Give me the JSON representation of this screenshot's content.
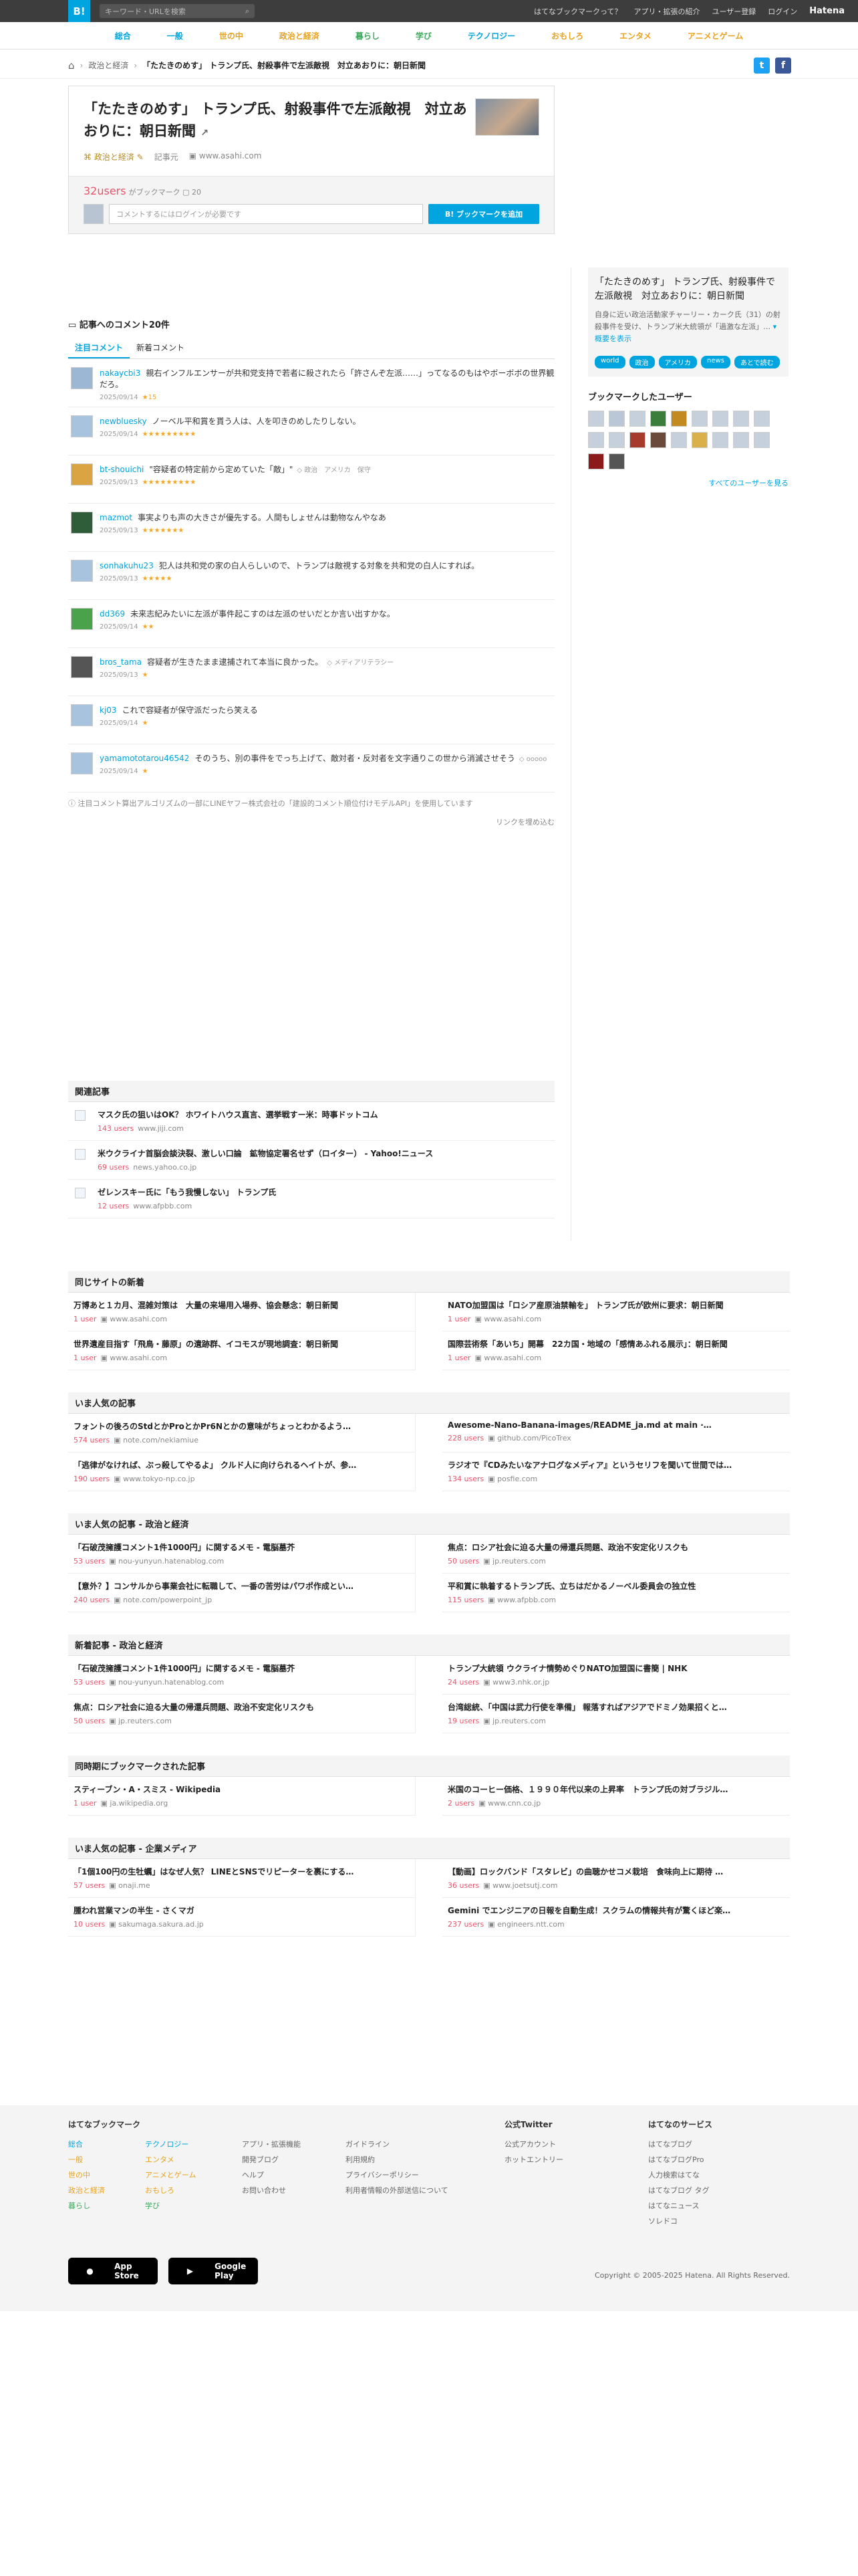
{
  "topbar": {
    "logo": "B!",
    "search_placeholder": "キーワード・URLを検索",
    "links": [
      "はてなブックマークって？",
      "アプリ・拡張の紹介",
      "ユーザー登録",
      "ログイン"
    ],
    "brand": "Hatena"
  },
  "categories": [
    {
      "label": "総合",
      "color": "#00a4de"
    },
    {
      "label": "一般",
      "color": "#00a4de"
    },
    {
      "label": "世の中",
      "color": "#e9a21d"
    },
    {
      "label": "政治と経済",
      "color": "#e9a21d"
    },
    {
      "label": "暮らし",
      "color": "#3daa5e"
    },
    {
      "label": "学び",
      "color": "#3daa5e"
    },
    {
      "label": "テクノロジー",
      "color": "#00a4de"
    },
    {
      "label": "おもしろ",
      "color": "#e9a21d"
    },
    {
      "label": "エンタメ",
      "color": "#e9a21d"
    },
    {
      "label": "アニメとゲーム",
      "color": "#e9a21d"
    }
  ],
  "breadcrumb": {
    "cat": "政治と経済",
    "current": "「たたきのめす」 トランプ氏、射殺事件で左派敵視　対立あおりに：朝日新聞"
  },
  "entry": {
    "title": "「たたきのめす」 トランプ氏、射殺事件で左派敵視　対立あおりに：朝日新聞",
    "category": "政治と経済",
    "kind": "記事元",
    "domain": "www.asahi.com",
    "users": "32users",
    "bm_label": "がブックマーク",
    "bm_count": "20",
    "comment_placeholder": "コメントするにはログインが必要です",
    "add_button": "B! ブックマークを追加"
  },
  "comments_section": {
    "title": "記事へのコメント20件",
    "tab_hot": "注目コメント",
    "tab_new": "新着コメント",
    "note": "ⓘ 注目コメント算出アルゴリズムの一部にLINEヤフー株式会社の「建設的コメント順位付けモデルAPI」を使用しています",
    "more": "リンクを埋め込む"
  },
  "comments": [
    {
      "user": "nakaycbi3",
      "text": "親右インフルエンサーが共和党支持で若者に殺されたら「許さんぞ左派……」ってなるのもはやボーボボの世界観だろ。",
      "tag": "",
      "date": "2025/09/14",
      "stars": "★15"
    },
    {
      "user": "newbluesky",
      "text": "ノーベル平和賞を貰う人は、人を叩きのめしたりしない。",
      "tag": "",
      "date": "2025/09/14",
      "stars": "★★★★★★★★★"
    },
    {
      "user": "bt-shouichi",
      "text": "\"容疑者の特定前から定めていた「敵」\"",
      "tag": "政治　アメリカ　保守",
      "date": "2025/09/13",
      "stars": "★★★★★★★★★"
    },
    {
      "user": "mazmot",
      "text": "事実よりも声の大きさが優先する。人間もしょせんは動物なんやなあ",
      "tag": "",
      "date": "2025/09/13",
      "stars": "★★★★★★★"
    },
    {
      "user": "sonhakuhu23",
      "text": "犯人は共和党の家の白人らしいので、トランプは敵視する対象を共和党の白人にすれば。",
      "tag": "",
      "date": "2025/09/13",
      "stars": "★★★★★"
    },
    {
      "user": "dd369",
      "text": "未来志紀みたいに左派が事件起こすのは左派のせいだとか言い出すかな。",
      "tag": "",
      "date": "2025/09/14",
      "stars": "★★"
    },
    {
      "user": "bros_tama",
      "text": "容疑者が生きたまま逮捕されて本当に良かった。",
      "tag": "メディアリテラシー",
      "date": "2025/09/13",
      "stars": "★"
    },
    {
      "user": "kj03",
      "text": "これで容疑者が保守派だったら笑える",
      "tag": "",
      "date": "2025/09/14",
      "stars": "★"
    },
    {
      "user": "yamamototarou46542",
      "text": "そのうち、別の事件をでっち上げて、敵対者・反対者を文字通りこの世から消滅させそう",
      "tag": "ooooo",
      "date": "2025/09/14",
      "stars": "★"
    }
  ],
  "related": {
    "title": "関連記事",
    "items": [
      {
        "title": "マスク氏の狙いはOK？ ホワイトハウス直言、選挙戦すー米：時事ドットコム",
        "users": "143 users",
        "domain": "www.jiji.com"
      },
      {
        "title": "米ウクライナ首脳会談決裂、激しい口論　鉱物協定署名せず（ロイター） - Yahoo!ニュース",
        "users": "69 users",
        "domain": "news.yahoo.co.jp"
      },
      {
        "title": "ゼレンスキー氏に「もう我慢しない」 トランプ氏",
        "users": "12 users",
        "domain": "www.afpbb.com"
      }
    ]
  },
  "sidebar": {
    "title": "「たたきのめす」 トランプ氏、射殺事件で左派敵視　対立あおりに：朝日新聞",
    "desc": "自身に近い政治活動家チャーリー・カーク氏（31）の射殺事件を受け、トランプ米大統領が「過激な左派」…",
    "more": "概要を表示",
    "tags": [
      "world",
      "政治",
      "アメリカ",
      "news",
      "あとで読む"
    ],
    "users_title": "ブックマークしたユーザー",
    "all_users": "すべてのユーザーを見る"
  },
  "blocks": [
    {
      "title": "同じサイトの新着",
      "items": [
        {
          "title": "万博あと１カ月、混雑対策は　大量の来場用入場券、協会懸念：朝日新聞",
          "users": "1 user",
          "domain": "www.asahi.com"
        },
        {
          "title": "NATO加盟国は「ロシア産原油禁輸を」 トランプ氏が欧州に要求：朝日新聞",
          "users": "1 user",
          "domain": "www.asahi.com"
        },
        {
          "title": "世界遺産目指す「飛鳥・藤原」の遺跡群、イコモスが現地調査：朝日新聞",
          "users": "1 user",
          "domain": "www.asahi.com"
        },
        {
          "title": "国際芸術祭「あいち」開幕　22カ国・地域の「感情あふれる展示」：朝日新聞",
          "users": "1 user",
          "domain": "www.asahi.com"
        }
      ]
    },
    {
      "title": "いま人気の記事",
      "items": [
        {
          "title": "フォントの後ろのStdとかProとかPr6Nとかの意味がちょっとわかるよう…",
          "users": "574 users",
          "domain": "note.com/nekiamiue"
        },
        {
          "title": "Awesome-Nano-Banana-images/README_ja.md at main ·…",
          "users": "228 users",
          "domain": "github.com/PicoTrex"
        },
        {
          "title": "「逃律がなければ、ぶっ殺してやるよ」 クルド人に向けられるヘイトが、参…",
          "users": "190 users",
          "domain": "www.tokyo-np.co.jp"
        },
        {
          "title": "ラジオで『CDみたいなアナログなメディア』というセリフを聞いて世間では…",
          "users": "134 users",
          "domain": "posfie.com"
        }
      ]
    },
    {
      "title": "いま人気の記事 - 政治と経済",
      "items": [
        {
          "title": "「石破茂擁護コメント1件1000円」に関するメモ - 電脳墓芥",
          "users": "53 users",
          "domain": "nou-yunyun.hatenablog.com"
        },
        {
          "title": "焦点：ロシア社会に迫る大量の帰還兵問題、政治不安定化リスクも",
          "users": "50 users",
          "domain": "jp.reuters.com"
        },
        {
          "title": "【意外？】コンサルから事業会社に転職して、一番の苦労はパワポ作成とい…",
          "users": "240 users",
          "domain": "note.com/powerpoint_jp"
        },
        {
          "title": "平和賞に執着するトランプ氏、立ちはだかるノーベル委員会の独立性",
          "users": "115 users",
          "domain": "www.afpbb.com"
        }
      ]
    },
    {
      "title": "新着記事 - 政治と経済",
      "items": [
        {
          "title": "「石破茂擁護コメント1件1000円」に関するメモ - 電脳墓芥",
          "users": "53 users",
          "domain": "nou-yunyun.hatenablog.com"
        },
        {
          "title": "トランプ大統領 ウクライナ情勢めぐりNATO加盟国に書簡 | NHK",
          "users": "24 users",
          "domain": "www3.nhk.or.jp"
        },
        {
          "title": "焦点：ロシア社会に迫る大量の帰還兵問題、政治不安定化リスクも",
          "users": "50 users",
          "domain": "jp.reuters.com"
        },
        {
          "title": "台湾総統、「中国は武力行使を準備」 報落すればアジアでドミノ効果招くと…",
          "users": "19 users",
          "domain": "jp.reuters.com"
        }
      ]
    },
    {
      "title": "同時期にブックマークされた記事",
      "items": [
        {
          "title": "スティーブン・A・スミス - Wikipedia",
          "users": "1 user",
          "domain": "ja.wikipedia.org"
        },
        {
          "title": "米国のコーヒー価格、１９９０年代以来の上昇率　トランプ氏の対ブラジル…",
          "users": "2 users",
          "domain": "www.cnn.co.jp"
        }
      ]
    },
    {
      "title": "いま人気の記事 - 企業メディア",
      "items": [
        {
          "title": "「1個100円の生牡蠣」はなぜ人気？ LINEとSNSでリピーターを裹にする…",
          "users": "57 users",
          "domain": "onaji.me"
        },
        {
          "title": "【動画】ロックバンド「スタレビ」の曲聴かせコメ栽培　食味向上に期待 …",
          "users": "36 users",
          "domain": "www.joetsutj.com"
        },
        {
          "title": "腫われ営業マンの半生 - さくマガ",
          "users": "10 users",
          "domain": "sakumaga.sakura.ad.jp"
        },
        {
          "title": "Gemini でエンジニアの日報を自動生成！スクラムの情報共有が驚くほど楽…",
          "users": "237 users",
          "domain": "engineers.ntt.com"
        }
      ]
    }
  ],
  "footer": {
    "title": "はてなブックマーク",
    "cats": [
      "総合",
      "テクノロジー",
      "一般",
      "エンタメ",
      "世の中",
      "アニメとゲーム",
      "政治と経済",
      "おもしろ",
      "暮らし",
      "学び"
    ],
    "col2": [
      "アプリ・拡張機能",
      "開発ブログ",
      "ヘルプ",
      "お問い合わせ"
    ],
    "col3": [
      "ガイドライン",
      "利用規約",
      "プライバシーポリシー",
      "利用者情報の外部送信について"
    ],
    "twitter_title": "公式Twitter",
    "twitter": [
      "公式アカウント",
      "ホットエントリー"
    ],
    "services_title": "はてなのサービス",
    "services": [
      "はてなブログ",
      "はてなブログPro",
      "人力検索はてな",
      "はてなブログ タグ",
      "はてなニュース",
      "ソレドコ"
    ],
    "appstore": "App Store",
    "googleplay": "Google Play",
    "copyright": "Copyright © 2005-2025 Hatena. All Rights Reserved."
  }
}
